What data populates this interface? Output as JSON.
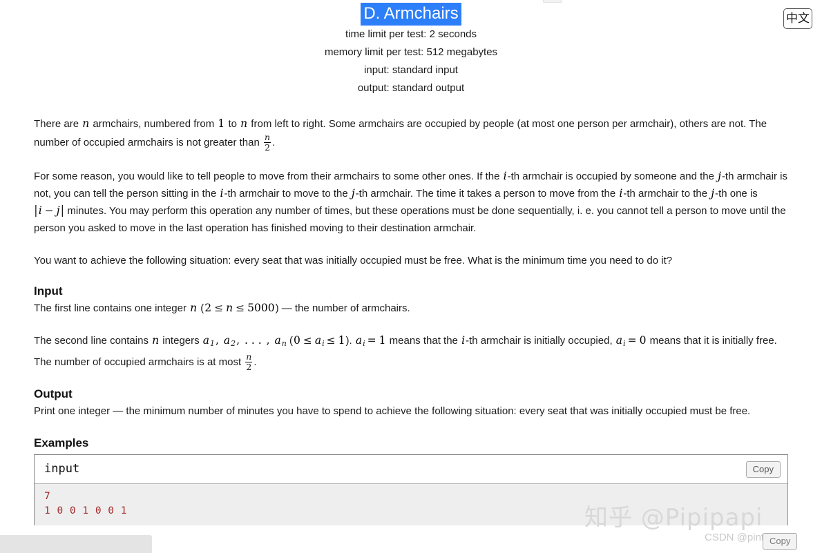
{
  "window": {
    "lang_toggle_label": "中文"
  },
  "problem": {
    "title": "D. Armchairs",
    "time_limit": "time limit per test: 2 seconds",
    "memory_limit": "memory limit per test: 512 megabytes",
    "input_spec": "input: standard input",
    "output_spec": "output: standard output",
    "selection_color": "#2d7ff9"
  },
  "statement": {
    "p1": {
      "t1": "There are ",
      "m1": "n",
      "t2": " armchairs, numbered from ",
      "m2": "1",
      "t3": " to ",
      "m3": "n",
      "t4": " from left to right. Some armchairs are occupied by people (at most one person per armchair), others are not. The number of occupied armchairs is not greater than ",
      "frac_num": "n",
      "frac_den": "2",
      "t5": "."
    },
    "p2": {
      "t1": "For some reason, you would like to tell people to move from their armchairs to some other ones. If the ",
      "m1": "i",
      "t2": "-th armchair is occupied by someone and the ",
      "m2": "j",
      "t3": "-th armchair is not, you can tell the person sitting in the ",
      "m3": "i",
      "t4": "-th armchair to move to the ",
      "m4": "j",
      "t5": "-th armchair. The time it takes a person to move from the ",
      "m5": "i",
      "t6": "-th armchair to the ",
      "m6": "j",
      "t7": "-th one is ",
      "abs_i": "i",
      "abs_minus": "−",
      "abs_j": "j",
      "t8": " minutes. You may perform this operation any number of times, but these operations must be done sequentially, i. e. you cannot tell a person to move until the person you asked to move in the last operation has finished moving to their destination armchair."
    },
    "p3": "You want to achieve the following situation: every seat that was initially occupied must be free. What is the minimum time you need to do it?"
  },
  "input_section": {
    "heading": "Input",
    "p1": {
      "t1": "The first line contains one integer ",
      "m1": "n",
      "t2": " (",
      "m2": "2",
      "le1": "≤",
      "m3": "n",
      "le2": "≤",
      "m4": "5000",
      "t3": ") — the number of armchairs."
    },
    "p2": {
      "t1": "The second line contains ",
      "m1": "n",
      "t2": " integers ",
      "a1": "a",
      "a1s": "1",
      "c1": ", ",
      "a2": "a",
      "a2s": "2",
      "c2": ", ",
      "dots": ". . . ",
      "c3": ", ",
      "a3": "a",
      "a3s": "n",
      "t3": " (",
      "zero": "0",
      "le1": "≤",
      "ai1": "a",
      "ai1s": "i",
      "le2": "≤",
      "one": "1",
      "t4": "). ",
      "ai2": "a",
      "ai2s": "i",
      "eq1": "=",
      "one2": "1",
      "t5": " means that the ",
      "mi": "i",
      "t6": "-th armchair is initially occupied, ",
      "ai3": "a",
      "ai3s": "i",
      "eq2": "=",
      "zero2": "0",
      "t7": " means that it is initially free. The number of occupied armchairs is at most ",
      "frac_num": "n",
      "frac_den": "2",
      "t8": "."
    }
  },
  "output_section": {
    "heading": "Output",
    "p1": "Print one integer — the minimum number of minutes you have to spend to achieve the following situation: every seat that was initially occupied must be free."
  },
  "examples": {
    "heading": "Examples",
    "io_label": "input",
    "copy_label": "Copy",
    "copy_label_bottom": "Copy",
    "sample_input": "7\n1 0 0 1 0 0 1"
  },
  "watermarks": {
    "zhihu": "知乎 @Pipipapi",
    "csdn": "CSDN @pintopapi"
  }
}
